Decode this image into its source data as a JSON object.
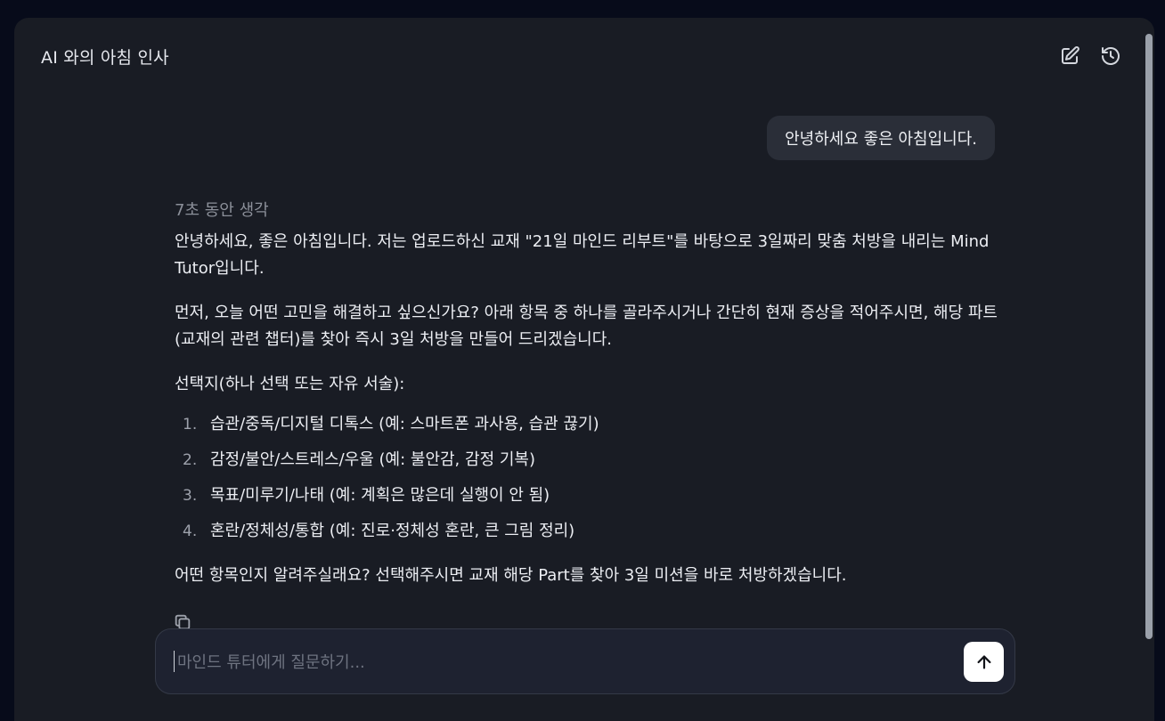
{
  "header": {
    "title": "AI 와의 아침 인사",
    "icons": [
      "edit-icon",
      "history-icon"
    ]
  },
  "user_message": "안녕하세요 좋은 아침입니다.",
  "ai_message": {
    "thinking": "7초 동안 생각",
    "para1": "안녕하세요, 좋은 아침입니다. 저는 업로드하신 교재 \"21일 마인드 리부트\"를 바탕으로 3일짜리 맞춤 처방을 내리는 Mind Tutor입니다.",
    "para2": "먼저, 오늘 어떤 고민을 해결하고 싶으신가요? 아래 항목 중 하나를 골라주시거나 간단히 현재 증상을 적어주시면, 해당 파트(교재의 관련 챕터)를 찾아 즉시 3일 처방을 만들어 드리겠습니다.",
    "para3": "선택지(하나 선택 또는 자유 서술):",
    "options": [
      {
        "num": "1.",
        "text": "습관/중독/디지털 디톡스 (예: 스마트폰 과사용, 습관 끊기)"
      },
      {
        "num": "2.",
        "text": "감정/불안/스트레스/우울 (예: 불안감, 감정 기복)"
      },
      {
        "num": "3.",
        "text": "목표/미루기/나태 (예: 계획은 많은데 실행이 안 됨)"
      },
      {
        "num": "4.",
        "text": "혼란/정체성/통합 (예: 진로·정체성 혼란, 큰 그림 정리)"
      }
    ],
    "para4": "어떤 항목인지 알려주실래요? 선택해주시면 교재 해당 Part를 찾아 3일 미션을 바로 처방하겠습니다."
  },
  "composer": {
    "placeholder": "마인드 튜터에게 질문하기...",
    "value": ""
  },
  "colors": {
    "page_bg": "#070b1a",
    "panel_bg": "#191c24",
    "bubble_bg": "#2a2e38",
    "input_bg": "#1e2230",
    "send_bg": "#ffffff"
  }
}
